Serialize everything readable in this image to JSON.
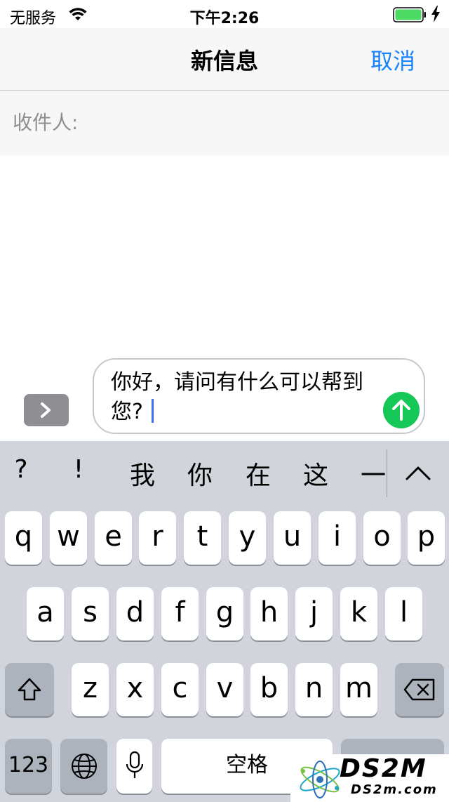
{
  "status_bar": {
    "carrier": "无服务",
    "time": "下午2:26",
    "battery_color": "#4cd964"
  },
  "nav": {
    "title": "新信息",
    "cancel_label": "取消",
    "accent_color": "#1a82fb"
  },
  "recipient": {
    "label": "收件人:"
  },
  "compose": {
    "text": "你好，请问有什么可以帮到您?",
    "send_icon": "arrow-up-icon",
    "send_color": "#14c757",
    "apps_icon": "chevron-right-icon"
  },
  "keyboard": {
    "candidates": [
      "?",
      "!",
      "我",
      "你",
      "在",
      "这",
      "一"
    ],
    "expand_icon": "chevron-up-icon",
    "row1": [
      "q",
      "w",
      "e",
      "r",
      "t",
      "y",
      "u",
      "i",
      "o",
      "p"
    ],
    "row2": [
      "a",
      "s",
      "d",
      "f",
      "g",
      "h",
      "j",
      "k",
      "l"
    ],
    "row3": [
      "z",
      "x",
      "c",
      "v",
      "b",
      "n",
      "m"
    ],
    "shift_icon": "shift-icon",
    "delete_icon": "backspace-icon",
    "numbers_label": "123",
    "globe_icon": "globe-icon",
    "mic_icon": "microphone-icon",
    "space_label": "空格"
  },
  "watermark": {
    "brand": "DS2M",
    "site": "DS2m.com"
  }
}
